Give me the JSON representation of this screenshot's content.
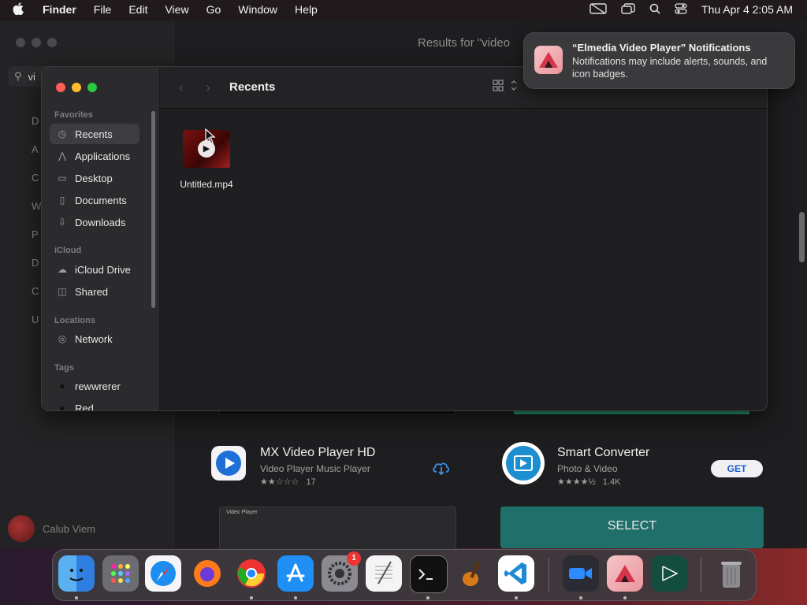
{
  "menubar": {
    "app": "Finder",
    "items": [
      "File",
      "Edit",
      "View",
      "Go",
      "Window",
      "Help"
    ],
    "datetime": "Thu Apr 4  2:05 AM"
  },
  "appstore": {
    "title": "Results for \"video",
    "search_value": "vi",
    "sidebar_letters": [
      "D",
      "A",
      "C",
      "W",
      "P",
      "D",
      "C",
      "U"
    ],
    "user_name": "Calub Viem",
    "apps": [
      {
        "name": "MX Video Player HD",
        "subtitle": "Video Player Music Player",
        "rating_count": "17",
        "stars": 2
      },
      {
        "name": "Smart Converter",
        "subtitle": "Photo & Video",
        "rating_count": "1.4K",
        "stars": 4.5,
        "action": "GET"
      }
    ],
    "select_banner": "SELECT",
    "thumb_label": "Video Player"
  },
  "finder": {
    "title": "Recents",
    "sections": {
      "favorites": "Favorites",
      "icloud": "iCloud",
      "locations": "Locations",
      "tags": "Tags"
    },
    "favorites": [
      "Recents",
      "Applications",
      "Desktop",
      "Documents",
      "Downloads"
    ],
    "icloud_items": [
      "iCloud Drive",
      "Shared"
    ],
    "locations_items": [
      "Network"
    ],
    "tags_items": [
      "rewwrerer",
      "Red"
    ],
    "files": [
      {
        "name": "Untitled.mp4"
      }
    ]
  },
  "notification": {
    "title": "“Elmedia Video Player” Notifications",
    "body": "Notifications may include alerts, sounds, and icon badges."
  },
  "dock": {
    "badge_settings": "1"
  }
}
